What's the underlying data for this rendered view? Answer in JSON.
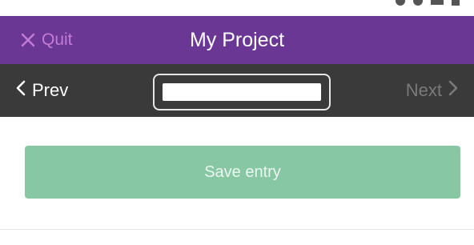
{
  "app_bar": {
    "quit_label": "Quit",
    "title": "My Project",
    "background": "#6b3794",
    "quit_color": "#c47bd6"
  },
  "nav_bar": {
    "prev_label": "Prev",
    "next_label": "Next",
    "entry_value": "",
    "background": "#3a3a3a"
  },
  "main": {
    "save_label": "Save entry",
    "save_color": "#87c7a4"
  }
}
